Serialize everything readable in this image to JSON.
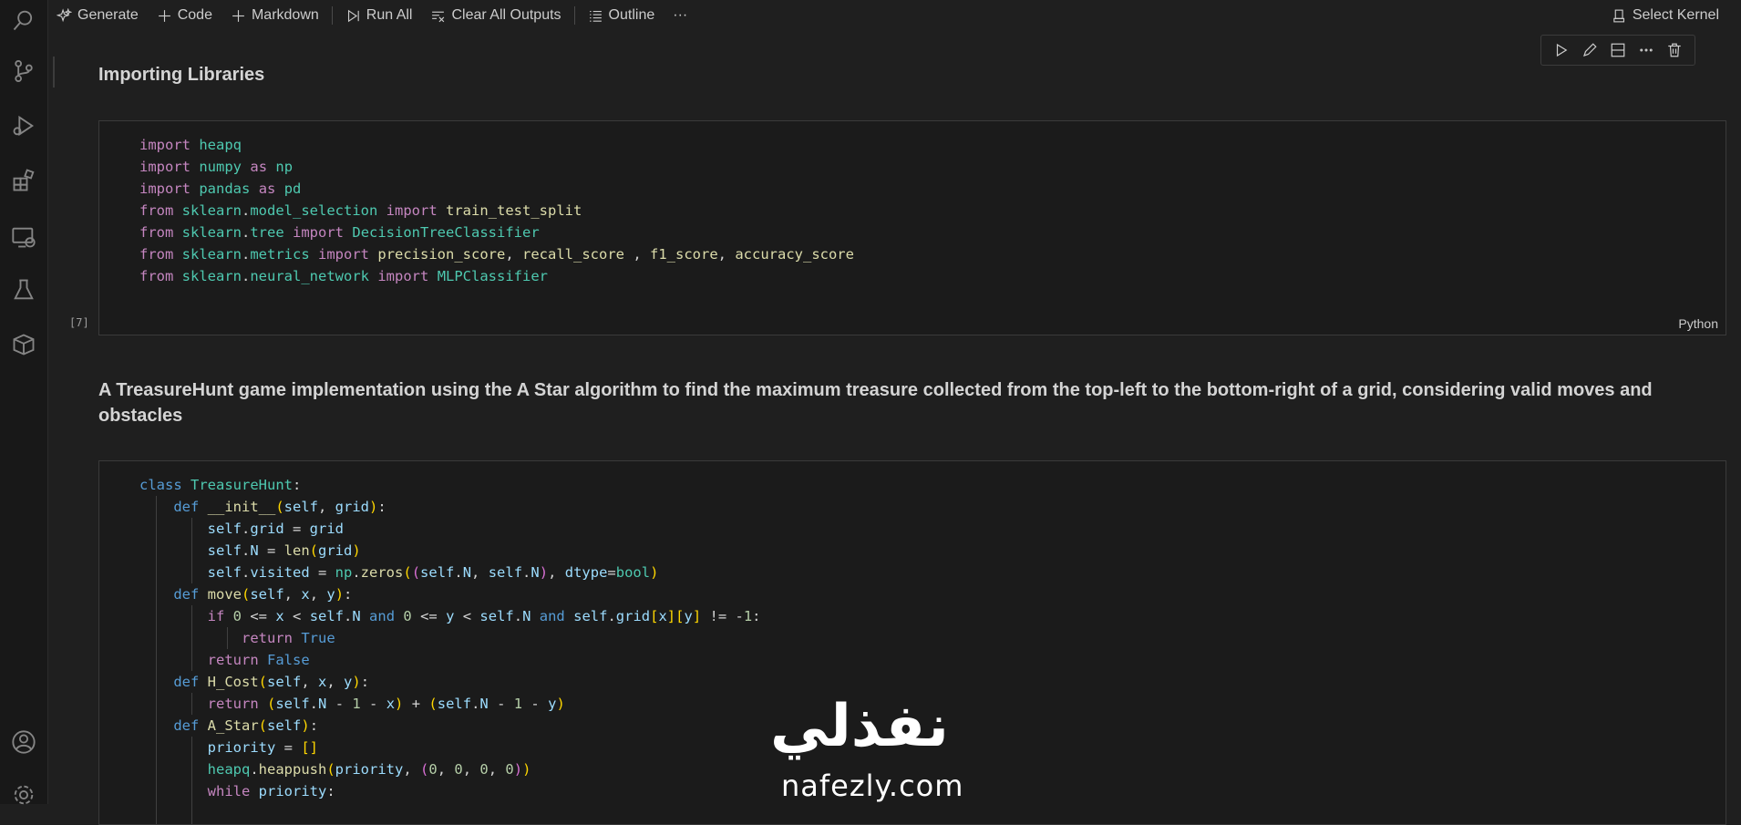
{
  "toolbar": {
    "generate": "Generate",
    "code": "Code",
    "markdown": "Markdown",
    "run_all": "Run All",
    "clear_outputs": "Clear All Outputs",
    "outline": "Outline",
    "more": "···",
    "select_kernel": "Select Kernel"
  },
  "cells": {
    "md1": "Importing Libraries",
    "code1_count": "[7]",
    "code1_lang": "Python",
    "md2": "A TreasureHunt game implementation using the A Star algorithm to find the maximum treasure collected from the top-left to the bottom-right of a grid, considering valid moves and obstacles"
  },
  "watermark": {
    "arabic": "نفذلي",
    "latin": "nafezly.com"
  },
  "colors": {
    "keyword": "#c586c0",
    "builtin": "#569cd6",
    "module": "#4ec9b0",
    "function": "#dcdcaa",
    "variable": "#9cdcfe",
    "number": "#b5cea8"
  }
}
